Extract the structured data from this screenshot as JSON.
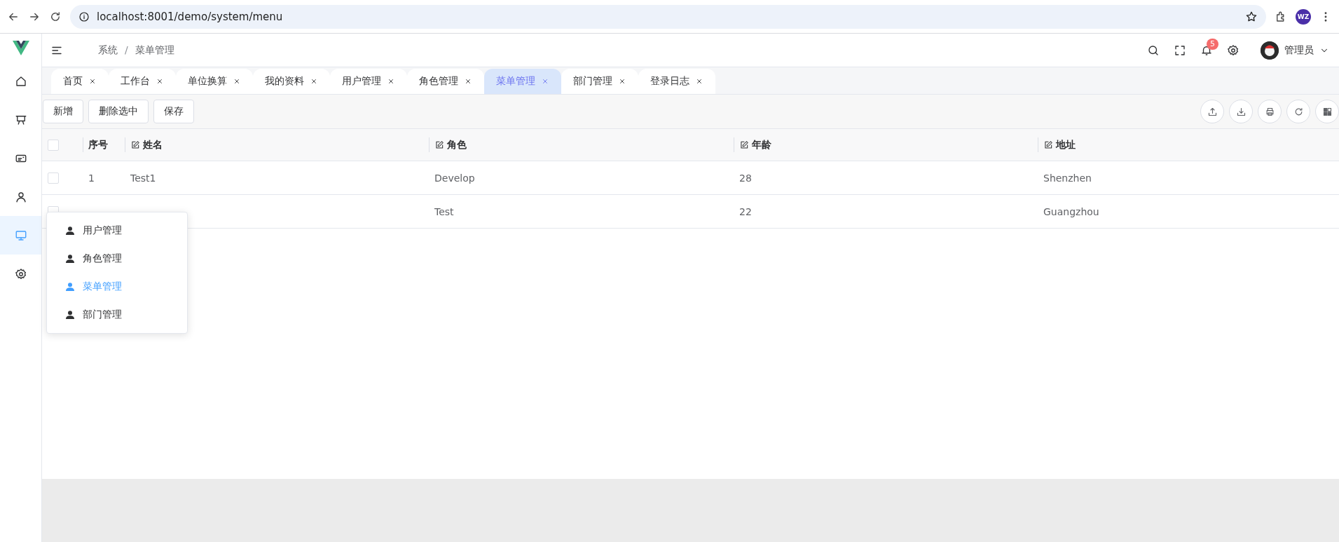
{
  "browser": {
    "url": "localhost:8001/demo/system/menu",
    "profile": "WZ"
  },
  "sidebar": {
    "items": [
      {
        "kind": "home",
        "selected": false
      },
      {
        "kind": "board",
        "selected": false
      },
      {
        "kind": "card",
        "selected": false
      },
      {
        "kind": "user",
        "selected": false
      },
      {
        "kind": "monitor",
        "selected": true
      },
      {
        "kind": "settings",
        "selected": false
      }
    ]
  },
  "header": {
    "breadcrumb": [
      "系统",
      "菜单管理"
    ],
    "breadcrumb_separator": "/",
    "notification_count": "5",
    "user": "管理员"
  },
  "tabs": [
    {
      "label": "首页",
      "selected": false
    },
    {
      "label": "工作台",
      "selected": false
    },
    {
      "label": "单位换算",
      "selected": false
    },
    {
      "label": "我的资料",
      "selected": false
    },
    {
      "label": "用户管理",
      "selected": false
    },
    {
      "label": "角色管理",
      "selected": false
    },
    {
      "label": "菜单管理",
      "selected": true
    },
    {
      "label": "部门管理",
      "selected": false
    },
    {
      "label": "登录日志",
      "selected": false
    }
  ],
  "toolbar": {
    "buttons": [
      "新增",
      "删除选中",
      "保存"
    ]
  },
  "table": {
    "all_checked": false,
    "columns": [
      {
        "label": "序号",
        "editable": false
      },
      {
        "label": "姓名",
        "editable": true
      },
      {
        "label": "角色",
        "editable": true
      },
      {
        "label": "年龄",
        "editable": true
      },
      {
        "label": "地址",
        "editable": true
      }
    ],
    "rows": [
      {
        "checked": false,
        "cells": [
          "1",
          "Test1",
          "Develop",
          "28",
          "Shenzhen"
        ]
      },
      {
        "checked": false,
        "cells": [
          null,
          null,
          "Test",
          "22",
          "Guangzhou"
        ]
      }
    ]
  },
  "popup_menu": {
    "items": [
      {
        "label": "用户管理",
        "selected": false
      },
      {
        "label": "角色管理",
        "selected": false
      },
      {
        "label": "菜单管理",
        "selected": true
      },
      {
        "label": "部门管理",
        "selected": false
      }
    ]
  }
}
